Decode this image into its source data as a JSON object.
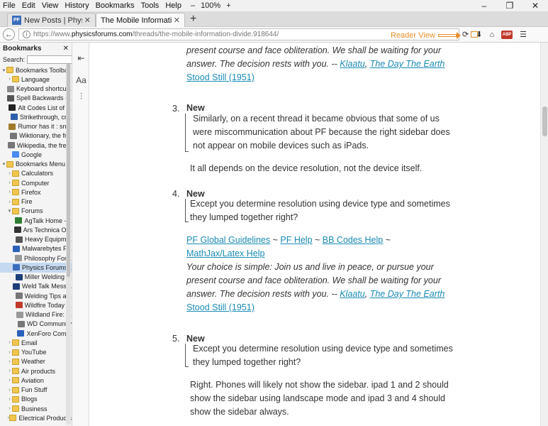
{
  "menu": [
    "File",
    "Edit",
    "View",
    "History",
    "Bookmarks",
    "Tools",
    "Help"
  ],
  "zoom": {
    "minus": "–",
    "level": "100%",
    "plus": "+"
  },
  "window_controls": [
    "–",
    "❐",
    "✕"
  ],
  "tabs": [
    {
      "favicon": "PF",
      "title": "New Posts | Physics Forums",
      "close": "✕"
    },
    {
      "title": "The Mobile Information Divide |",
      "close": "✕"
    }
  ],
  "newtab": "+",
  "url": {
    "prefix": "https://www.",
    "domain": "physicsforums.com",
    "path": "/threads/the-mobile-information-divide.918644/"
  },
  "annotation": {
    "reader_view": "Reader View",
    "color": "#e8902b"
  },
  "sidebar": {
    "title": "Bookmarks",
    "close": "✕",
    "search_label": "Search:",
    "items": [
      {
        "level": 0,
        "type": "folder",
        "label": "Bookmarks Toolbar",
        "twisty": "▾"
      },
      {
        "level": 1,
        "type": "folder",
        "label": "Language",
        "twisty": "›"
      },
      {
        "level": 1,
        "type": "bm",
        "label": "Keyboard shortcu...",
        "color": "#8a8a8a"
      },
      {
        "level": 1,
        "type": "bm",
        "label": "Spell Backwards -...",
        "color": "#555"
      },
      {
        "level": 1,
        "type": "bm",
        "label": "Alt Codes List of ...",
        "color": "#222"
      },
      {
        "level": 1,
        "type": "bm",
        "label": "Strikethrough, cr...",
        "color": "#2d5ea8"
      },
      {
        "level": 1,
        "type": "bm",
        "label": "Rumor has it : sn...",
        "color": "#a07a2a"
      },
      {
        "level": 1,
        "type": "bm",
        "label": "Wiktionary, the fr...",
        "color": "#777"
      },
      {
        "level": 1,
        "type": "bm",
        "label": "Wikipedia, the fre...",
        "color": "#777"
      },
      {
        "level": 1,
        "type": "bm",
        "label": "Google",
        "color": "#4a8af4"
      },
      {
        "level": 0,
        "type": "folder",
        "label": "Bookmarks Menu",
        "twisty": "▾"
      },
      {
        "level": 1,
        "type": "folder",
        "label": "Calculators",
        "twisty": "›"
      },
      {
        "level": 1,
        "type": "folder",
        "label": "Computer",
        "twisty": "›"
      },
      {
        "level": 1,
        "type": "folder",
        "label": "Firefox",
        "twisty": "›"
      },
      {
        "level": 1,
        "type": "folder",
        "label": "Fire",
        "twisty": "›"
      },
      {
        "level": 1,
        "type": "folder",
        "label": "Forums",
        "twisty": "▾"
      },
      {
        "level": 2,
        "type": "bm",
        "label": "AgTalk Home -...",
        "color": "#2f7d32"
      },
      {
        "level": 2,
        "type": "bm",
        "label": "Ars Technica O...",
        "color": "#333"
      },
      {
        "level": 2,
        "type": "bm",
        "label": "Heavy Equipm...",
        "color": "#555"
      },
      {
        "level": 2,
        "type": "bm",
        "label": "Malwarebytes F...",
        "color": "#2a62b8"
      },
      {
        "level": 2,
        "type": "bm",
        "label": "Philosophy For...",
        "color": "#999"
      },
      {
        "level": 2,
        "type": "bm",
        "label": "Physics Forums...",
        "color": "#3b6dbb",
        "selected": true
      },
      {
        "level": 2,
        "type": "bm",
        "label": "Miller Welding ...",
        "color": "#1c3f7a"
      },
      {
        "level": 2,
        "type": "bm",
        "label": "Weld Talk Mess...",
        "color": "#1c3f7a"
      },
      {
        "level": 2,
        "type": "bm",
        "label": "Welding Tips a...",
        "color": "#777"
      },
      {
        "level": 2,
        "type": "bm",
        "label": "Wildfire Today ...",
        "color": "#c0392b"
      },
      {
        "level": 2,
        "type": "bm",
        "label": "Wildland Fire: ...",
        "color": "#999"
      },
      {
        "level": 2,
        "type": "bm",
        "label": "WD Community",
        "color": "#777"
      },
      {
        "level": 2,
        "type": "bm",
        "label": "XenForo Com...",
        "color": "#2a62b8"
      },
      {
        "level": 1,
        "type": "folder",
        "label": "Email",
        "twisty": "›"
      },
      {
        "level": 1,
        "type": "folder",
        "label": "YouTube",
        "twisty": "›"
      },
      {
        "level": 1,
        "type": "folder",
        "label": "Weather",
        "twisty": "›"
      },
      {
        "level": 1,
        "type": "folder",
        "label": "Air products",
        "twisty": "›"
      },
      {
        "level": 1,
        "type": "folder",
        "label": "Aviation",
        "twisty": "›"
      },
      {
        "level": 1,
        "type": "folder",
        "label": "Fun Stuff",
        "twisty": "›"
      },
      {
        "level": 1,
        "type": "folder",
        "label": "Blogs",
        "twisty": "›"
      },
      {
        "level": 1,
        "type": "folder",
        "label": "Business",
        "twisty": "›"
      },
      {
        "level": 1,
        "type": "folder",
        "label": "Electrical Products",
        "twisty": "›"
      }
    ]
  },
  "reader_toolbar": {
    "type_controls": "Aa"
  },
  "content": {
    "top_quote": {
      "l1": "present course and face obliteration. We shall be waiting for your",
      "l2a": "answer. The decision rests with you. -- ",
      "l2b": "Klaatu",
      "l2c": ", ",
      "l2d": "The Day The Earth",
      "l3": "Stood Still (1951)"
    },
    "post3": {
      "num": "3.",
      "heading": "New",
      "q1": "Similarly, on a recent thread it became obvious that some of us",
      "q2": "were miscommunication about PF because the right sidebar does",
      "q3": "not appear on mobile devices such as iPads.",
      "reply": "It all depends on the device resolution, not the device itself."
    },
    "post4": {
      "num": "4.",
      "heading": "New",
      "q1": "Except you determine resolution using device type and sometimes",
      "q2": "they lumped together right?",
      "links": [
        "PF Global Guidelines",
        "PF Help",
        "BB Codes Help",
        "MathJax/Latex Help"
      ],
      "tilde": " ~ ",
      "tilde_end": " ~",
      "sig1": "Your choice is simple: Join us and live in peace, or pursue your",
      "sig2": "present course and face obliteration. We shall be waiting for your",
      "sig3a": "answer. The decision rests with you. -- ",
      "sig3b": "Klaatu",
      "sig3c": ", ",
      "sig3d": "The Day The Earth",
      "sig4": "Stood Still (1951)"
    },
    "post5": {
      "num": "5.",
      "heading": "New",
      "q1": "Except you determine resolution using device type and sometimes",
      "q2": "they lumped together right?",
      "r1": "Right. Phones will likely not show the sidebar. ipad 1 and 2 should",
      "r2": "show the sidebar using landscape mode and ipad 3 and 4 should",
      "r3": "show the sidebar always."
    }
  }
}
